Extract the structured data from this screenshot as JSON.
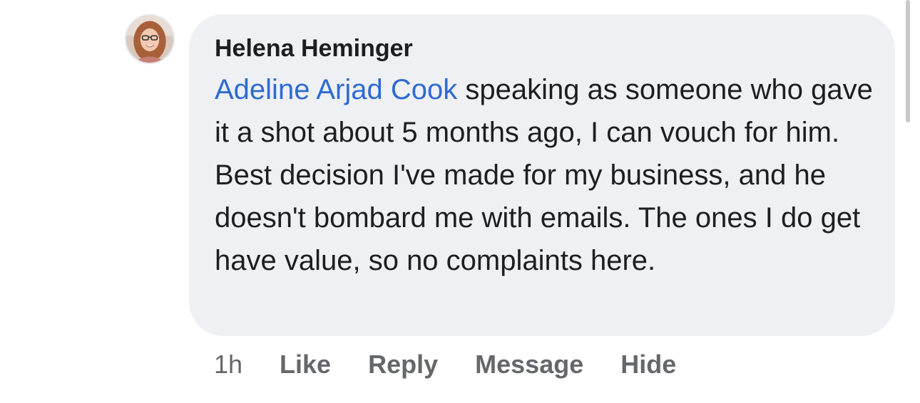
{
  "comment": {
    "author": "Helena Heminger",
    "mention": "Adeline Arjad Cook",
    "body": " speaking as someone who gave it a shot about 5 months ago, I can vouch for him. Best decision I've made for my business, and he doesn't bombard me with emails. The ones I do get have value, so no complaints here.",
    "timestamp": "1h",
    "actions": {
      "like": "Like",
      "reply": "Reply",
      "message": "Message",
      "hide": "Hide"
    }
  },
  "colors": {
    "bubble_bg": "#eff0f4",
    "mention": "#2d6bd2",
    "action_text": "#65676b",
    "text": "#1c1e21"
  },
  "icons": {
    "avatar": "profile-photo"
  }
}
